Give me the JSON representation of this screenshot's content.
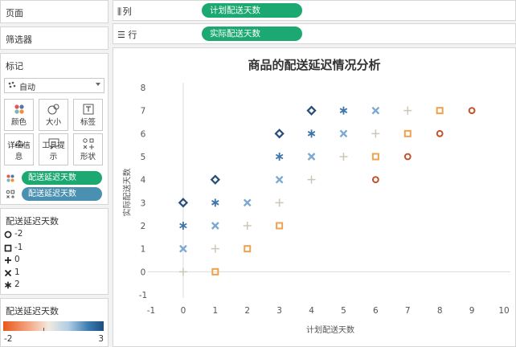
{
  "sidebar": {
    "pages_title": "页面",
    "filters_title": "筛选器",
    "marks_title": "标记",
    "marks_type": "自动",
    "mark_buttons": [
      {
        "label": "颜色",
        "icon": "color-dots-icon"
      },
      {
        "label": "大小",
        "icon": "size-icon"
      },
      {
        "label": "标签",
        "icon": "label-icon"
      },
      {
        "label": "详细信息",
        "icon": "detail-dots-icon"
      },
      {
        "label": "工具提示",
        "icon": "tooltip-icon"
      },
      {
        "label": "形状",
        "icon": "shape-icon"
      }
    ],
    "mark_pills": [
      {
        "label": "配送延迟天数",
        "icon": "color-dots-icon",
        "color": "#1ba871"
      },
      {
        "label": "配送延迟天数",
        "icon": "shape-icon",
        "color": "#4a90b0"
      }
    ],
    "shape_legend": {
      "title": "配送延迟天数",
      "items": [
        {
          "label": "-2",
          "shape": "circle"
        },
        {
          "label": "-1",
          "shape": "square"
        },
        {
          "label": "0",
          "shape": "plus"
        },
        {
          "label": "1",
          "shape": "cross"
        },
        {
          "label": "2",
          "shape": "asterisk"
        }
      ]
    },
    "color_legend": {
      "title": "配送延迟天数",
      "min": "-2",
      "max": "3"
    }
  },
  "shelves": {
    "columns_label": "列",
    "columns_pill": "计划配送天数",
    "rows_label": "行",
    "rows_pill": "实际配送天数"
  },
  "colors": {
    "pill_green": "#1ba871",
    "pill_blue": "#4a90b0",
    "delay_-2": "#c4522b",
    "delay_-1": "#f0a14e",
    "delay_0": "#cdc6b8",
    "delay_1": "#7ca9d1",
    "delay_2": "#3d75aa",
    "delay_3": "#274d78"
  },
  "chart_data": {
    "type": "scatter",
    "title": "商品的配送延迟情况分析",
    "xlabel": "计划配送天数",
    "ylabel": "实际配送天数",
    "xlim": [
      -1,
      10
    ],
    "ylim": [
      -1,
      8
    ],
    "xticks": [
      -1,
      0,
      1,
      2,
      3,
      4,
      5,
      6,
      7,
      8,
      9,
      10
    ],
    "yticks": [
      -1,
      0,
      1,
      2,
      3,
      4,
      5,
      6,
      7,
      8
    ],
    "grid": false,
    "points": [
      {
        "x": 0,
        "y": 0,
        "delay": 0
      },
      {
        "x": 0,
        "y": 1,
        "delay": 1
      },
      {
        "x": 0,
        "y": 2,
        "delay": 2
      },
      {
        "x": 0,
        "y": 3,
        "delay": 3
      },
      {
        "x": 1,
        "y": 0,
        "delay": -1
      },
      {
        "x": 1,
        "y": 1,
        "delay": 0
      },
      {
        "x": 1,
        "y": 2,
        "delay": 1
      },
      {
        "x": 1,
        "y": 3,
        "delay": 2
      },
      {
        "x": 1,
        "y": 4,
        "delay": 3
      },
      {
        "x": 2,
        "y": 1,
        "delay": -1
      },
      {
        "x": 2,
        "y": 2,
        "delay": 0
      },
      {
        "x": 2,
        "y": 3,
        "delay": 1
      },
      {
        "x": 3,
        "y": 2,
        "delay": -1
      },
      {
        "x": 3,
        "y": 3,
        "delay": 0
      },
      {
        "x": 3,
        "y": 4,
        "delay": 1
      },
      {
        "x": 3,
        "y": 5,
        "delay": 2
      },
      {
        "x": 3,
        "y": 6,
        "delay": 3
      },
      {
        "x": 4,
        "y": 4,
        "delay": 0
      },
      {
        "x": 4,
        "y": 5,
        "delay": 1
      },
      {
        "x": 4,
        "y": 6,
        "delay": 2
      },
      {
        "x": 4,
        "y": 7,
        "delay": 3
      },
      {
        "x": 5,
        "y": 5,
        "delay": 0
      },
      {
        "x": 5,
        "y": 6,
        "delay": 1
      },
      {
        "x": 5,
        "y": 7,
        "delay": 2
      },
      {
        "x": 6,
        "y": 4,
        "delay": -2
      },
      {
        "x": 6,
        "y": 5,
        "delay": -1
      },
      {
        "x": 6,
        "y": 6,
        "delay": 0
      },
      {
        "x": 6,
        "y": 7,
        "delay": 1
      },
      {
        "x": 7,
        "y": 5,
        "delay": -2
      },
      {
        "x": 7,
        "y": 6,
        "delay": -1
      },
      {
        "x": 7,
        "y": 7,
        "delay": 0
      },
      {
        "x": 8,
        "y": 6,
        "delay": -2
      },
      {
        "x": 8,
        "y": 7,
        "delay": -1
      },
      {
        "x": 9,
        "y": 7,
        "delay": -2
      }
    ]
  }
}
